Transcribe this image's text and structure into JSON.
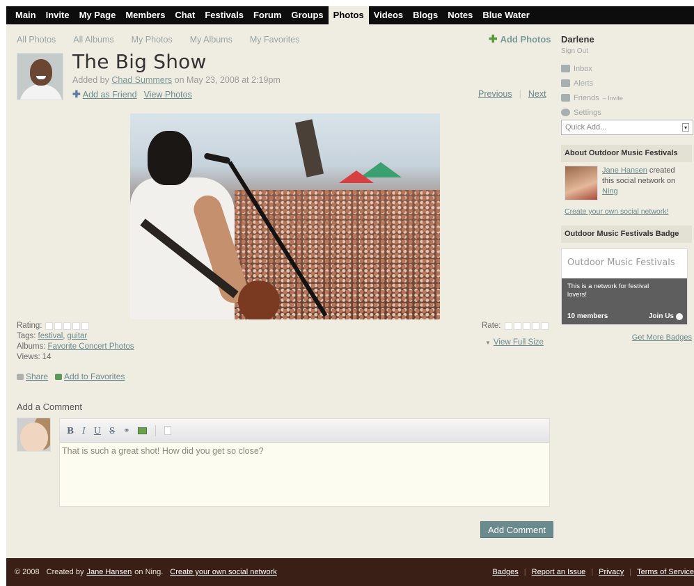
{
  "nav": {
    "items": [
      "Main",
      "Invite",
      "My Page",
      "Members",
      "Chat",
      "Festivals",
      "Forum",
      "Groups",
      "Photos",
      "Videos",
      "Blogs",
      "Notes",
      "Blue Water"
    ],
    "active": "Photos"
  },
  "subnav": {
    "items": [
      "All Photos",
      "All Albums",
      "My Photos",
      "My Albums",
      "My Favorites"
    ],
    "add_photos": "Add Photos"
  },
  "photo": {
    "title": "The Big Show",
    "added_prefix": "Added by",
    "author": "Chad Summers",
    "added_suffix": "on May 23, 2008 at 2:19pm",
    "add_friend": "Add as Friend",
    "view_photos": "View Photos",
    "previous": "Previous",
    "next": "Next",
    "separator": "|",
    "rating_label": "Rating:",
    "tags_label": "Tags:",
    "tags": [
      "festival",
      "guitar"
    ],
    "tags_comma": ",",
    "albums_label": "Albums:",
    "album": "Favorite Concert Photos",
    "views_label": "Views:",
    "views": "14",
    "share": "Share",
    "add_favorites": "Add to Favorites",
    "rate_label": "Rate:",
    "view_full_size": "View Full Size"
  },
  "comment": {
    "label": "Add a Comment",
    "toolbar": [
      "B",
      "I",
      "U",
      "S",
      "link",
      "image",
      "file"
    ],
    "text": "That is such a great shot! How did you get so close?",
    "button": "Add Comment"
  },
  "sidebar": {
    "user": "Darlene",
    "sign_out": "Sign Out",
    "links": [
      {
        "label": "Inbox",
        "icon": "inbox-icon"
      },
      {
        "label": "Alerts",
        "icon": "alerts-icon"
      },
      {
        "label": "Friends",
        "icon": "friends-icon",
        "extra": "– Invite"
      },
      {
        "label": "Settings",
        "icon": "settings-icon"
      }
    ],
    "quick_add": "Quick Add...",
    "about_title": "About Outdoor Music Festivals",
    "about_creator": "Jane Hansen",
    "about_text": "created this social network on",
    "about_ning": "Ning",
    "create_link": "Create your own social network!",
    "badge_title": "Outdoor Music Festivals Badge",
    "badge_name": "Outdoor Music Festivals",
    "badge_desc": "This is a network for festival lovers!",
    "badge_members": "10 members",
    "badge_join": "Join Us",
    "more_badges": "Get More Badges"
  },
  "footer": {
    "copyright": "© 2008",
    "created_by": "Created by",
    "creator": "Jane Hansen",
    "on_ning": "on Ning.",
    "create_link": "Create your own social network",
    "links": [
      "Badges",
      "Report an Issue",
      "Privacy",
      "Terms of Service"
    ]
  },
  "colors": {
    "nav_bg": "#0d0d0d",
    "page_bg": "#efece1",
    "link": "#6a8a8e",
    "button": "#6a8a8e",
    "footer_bg": "#3a1f16"
  }
}
